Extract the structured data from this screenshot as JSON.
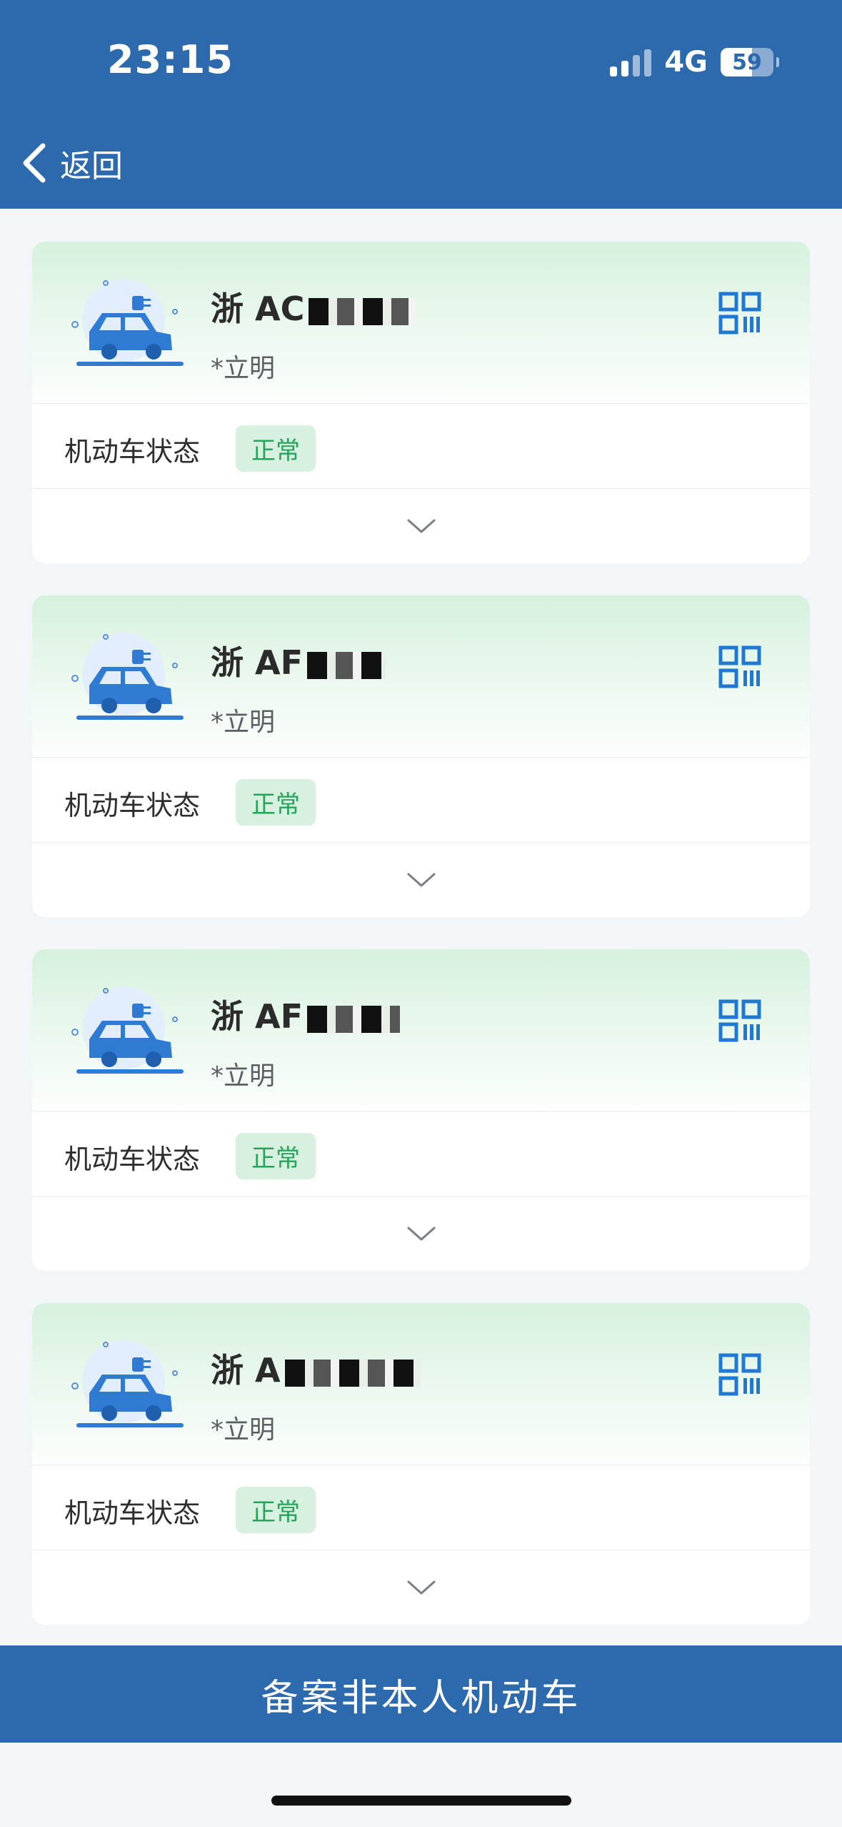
{
  "status_bar": {
    "time": "23:15",
    "network": "4G",
    "battery": "59"
  },
  "nav": {
    "back_label": "返回",
    "back_icon": "chevron-left-icon"
  },
  "vehicles": [
    {
      "plate_visible": "浙 AC",
      "owner": "*立明",
      "status_label": "机动车状态",
      "status_value": "正常"
    },
    {
      "plate_visible": "浙 AF",
      "owner": "*立明",
      "status_label": "机动车状态",
      "status_value": "正常"
    },
    {
      "plate_visible": "浙 AF",
      "owner": "*立明",
      "status_label": "机动车状态",
      "status_value": "正常"
    },
    {
      "plate_visible": "浙 A",
      "owner": "*立明",
      "status_label": "机动车状态",
      "status_value": "正常"
    }
  ],
  "bottom_action": {
    "label": "备案非本人机动车"
  },
  "colors": {
    "brand_blue": "#2d69ad",
    "icon_blue": "#1f78d1",
    "status_green": "#27a35a",
    "status_bg": "#d7f0e0"
  }
}
